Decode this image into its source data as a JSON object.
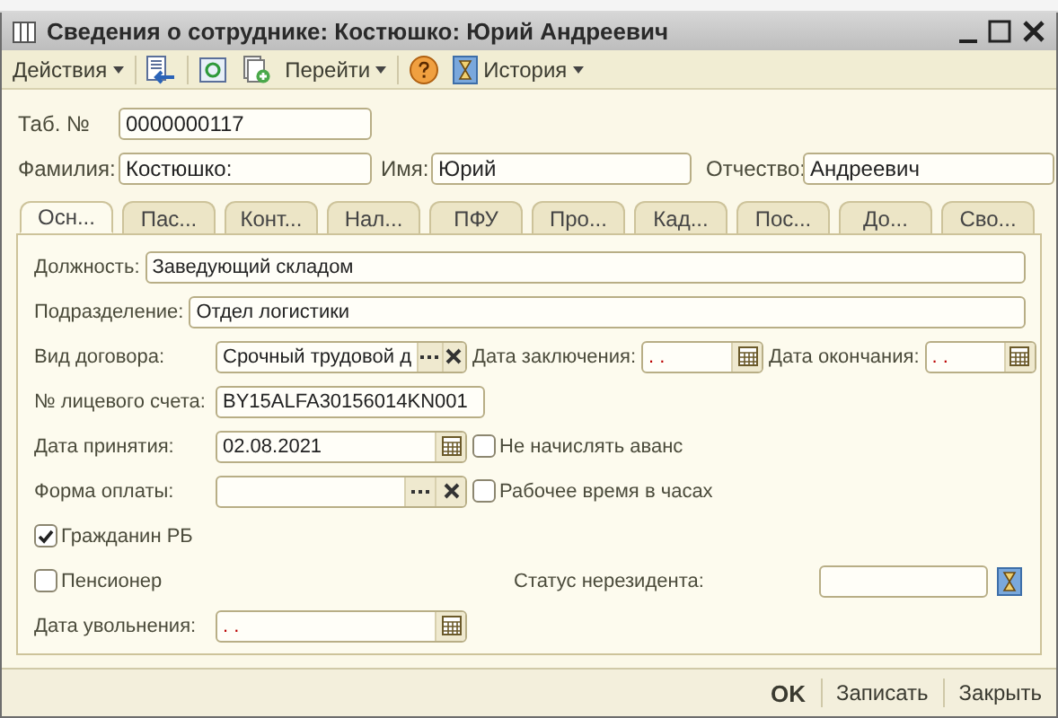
{
  "window": {
    "title": "Сведения о сотруднике: Костюшко: Юрий Андреевич"
  },
  "toolbar": [
    {
      "kind": "menu",
      "label": "Действия"
    },
    {
      "kind": "icon"
    },
    {
      "kind": "icon"
    },
    {
      "kind": "icon"
    },
    {
      "kind": "menu",
      "label": "Перейти"
    },
    {
      "kind": "icon"
    },
    {
      "kind": "icon_menu",
      "label": "История"
    }
  ],
  "header": {
    "tab_no": {
      "label": "Таб. №",
      "value": "0000000117"
    },
    "surname": {
      "label": "Фамилия:",
      "value": "Костюшко:"
    },
    "name": {
      "label": "Имя:",
      "value": "Юрий"
    },
    "patronymic": {
      "label": "Отчество:",
      "value": "Андреевич"
    }
  },
  "tabs": [
    {
      "label": "Осн...",
      "selected": true
    },
    {
      "label": "Пас...",
      "selected": false
    },
    {
      "label": "Конт...",
      "selected": false
    },
    {
      "label": "Нал...",
      "selected": false
    },
    {
      "label": "ПФУ",
      "selected": false
    },
    {
      "label": "Про...",
      "selected": false
    },
    {
      "label": "Кад...",
      "selected": false
    },
    {
      "label": "Пос...",
      "selected": false
    },
    {
      "label": "До...",
      "selected": false
    },
    {
      "label": "Сво...",
      "selected": false
    }
  ],
  "form": [
    {
      "items": [
        {
          "kind": "label",
          "text": "Должность:"
        },
        {
          "kind": "field",
          "value": "Заведующий складом"
        }
      ]
    },
    {
      "items": [
        {
          "kind": "label",
          "text": "Подразделение:"
        },
        {
          "kind": "field",
          "value": "Отдел логистики"
        }
      ]
    },
    {
      "items": [
        {
          "kind": "label",
          "text": "Вид договора:"
        },
        {
          "kind": "select",
          "value": "Срочный трудовой д"
        },
        {
          "kind": "label",
          "text": "Дата заключения:"
        },
        {
          "kind": "date",
          "value": ". ."
        },
        {
          "kind": "label",
          "text": "Дата окончания:"
        },
        {
          "kind": "date",
          "value": ". ."
        }
      ]
    },
    {
      "items": [
        {
          "kind": "label",
          "text": "№ лицевого счета:"
        },
        {
          "kind": "field",
          "value": "BY15ALFA30156014KN001"
        }
      ]
    },
    {
      "items": [
        {
          "kind": "label",
          "text": "Дата принятия:"
        },
        {
          "kind": "date",
          "value": "02.08.2021"
        },
        {
          "kind": "checkbox",
          "label": "Не начислять аванс",
          "checked": false
        }
      ]
    },
    {
      "items": [
        {
          "kind": "label",
          "text": "Форма оплаты:"
        },
        {
          "kind": "select",
          "value": ""
        },
        {
          "kind": "checkbox",
          "label": "Рабочее время в часах",
          "checked": false
        }
      ]
    },
    {
      "items": [
        {
          "kind": "checkbox",
          "label": "Гражданин РБ",
          "checked": true
        }
      ]
    },
    {
      "items": [
        {
          "kind": "checkbox",
          "label": "Пенсионер",
          "checked": false
        },
        {
          "kind": "label",
          "text": "Статус нерезидента:"
        },
        {
          "kind": "lookup",
          "value": ""
        }
      ]
    },
    {
      "items": [
        {
          "kind": "label",
          "text": "Дата увольнения:"
        },
        {
          "kind": "date",
          "value": ". ."
        }
      ]
    }
  ],
  "footer": [
    {
      "label": "OK",
      "default": true
    },
    {
      "label": "Записать",
      "default": false
    },
    {
      "label": "Закрыть",
      "default": false
    }
  ]
}
